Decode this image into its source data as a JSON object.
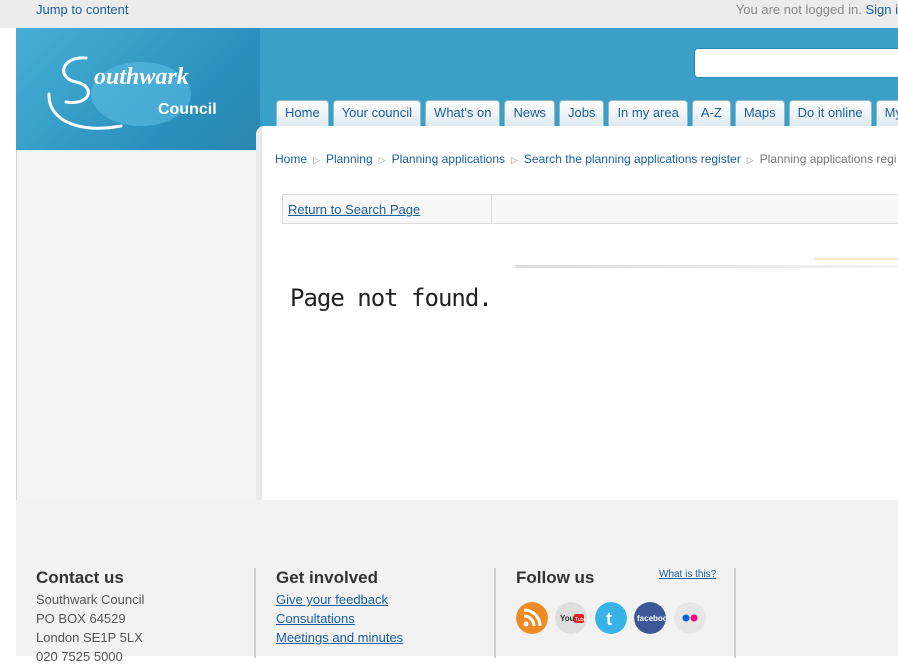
{
  "topbar": {
    "skip_label": "Jump to content",
    "status_text": "You are not logged in.",
    "signin_label": "Sign i"
  },
  "nav": {
    "items": [
      "Home",
      "Your council",
      "What's on",
      "News",
      "Jobs",
      "In my area",
      "A-Z",
      "Maps",
      "Do it online",
      "My"
    ]
  },
  "breadcrumb": {
    "items": [
      "Home",
      "Planning",
      "Planning applications",
      "Search the planning applications register"
    ],
    "current": "Planning applications regi"
  },
  "content": {
    "return_label": "Return to Search Page",
    "message": "Page not found."
  },
  "footer": {
    "contact": {
      "title": "Contact us",
      "lines": [
        "Southwark Council",
        "PO BOX 64529",
        "London SE1P 5LX",
        "020 7525 5000"
      ]
    },
    "involved": {
      "title": "Get involved",
      "links": [
        "Give your feedback",
        "Consultations",
        "Meetings and minutes"
      ]
    },
    "follow": {
      "title": "Follow us",
      "what_is_label": "What is this?"
    }
  },
  "icons": [
    "rss-icon",
    "youtube-icon",
    "twitter-icon",
    "facebook-icon",
    "flickr-icon"
  ],
  "colors": {
    "brand": "#3aa0c8",
    "link": "#1a5fa0"
  }
}
